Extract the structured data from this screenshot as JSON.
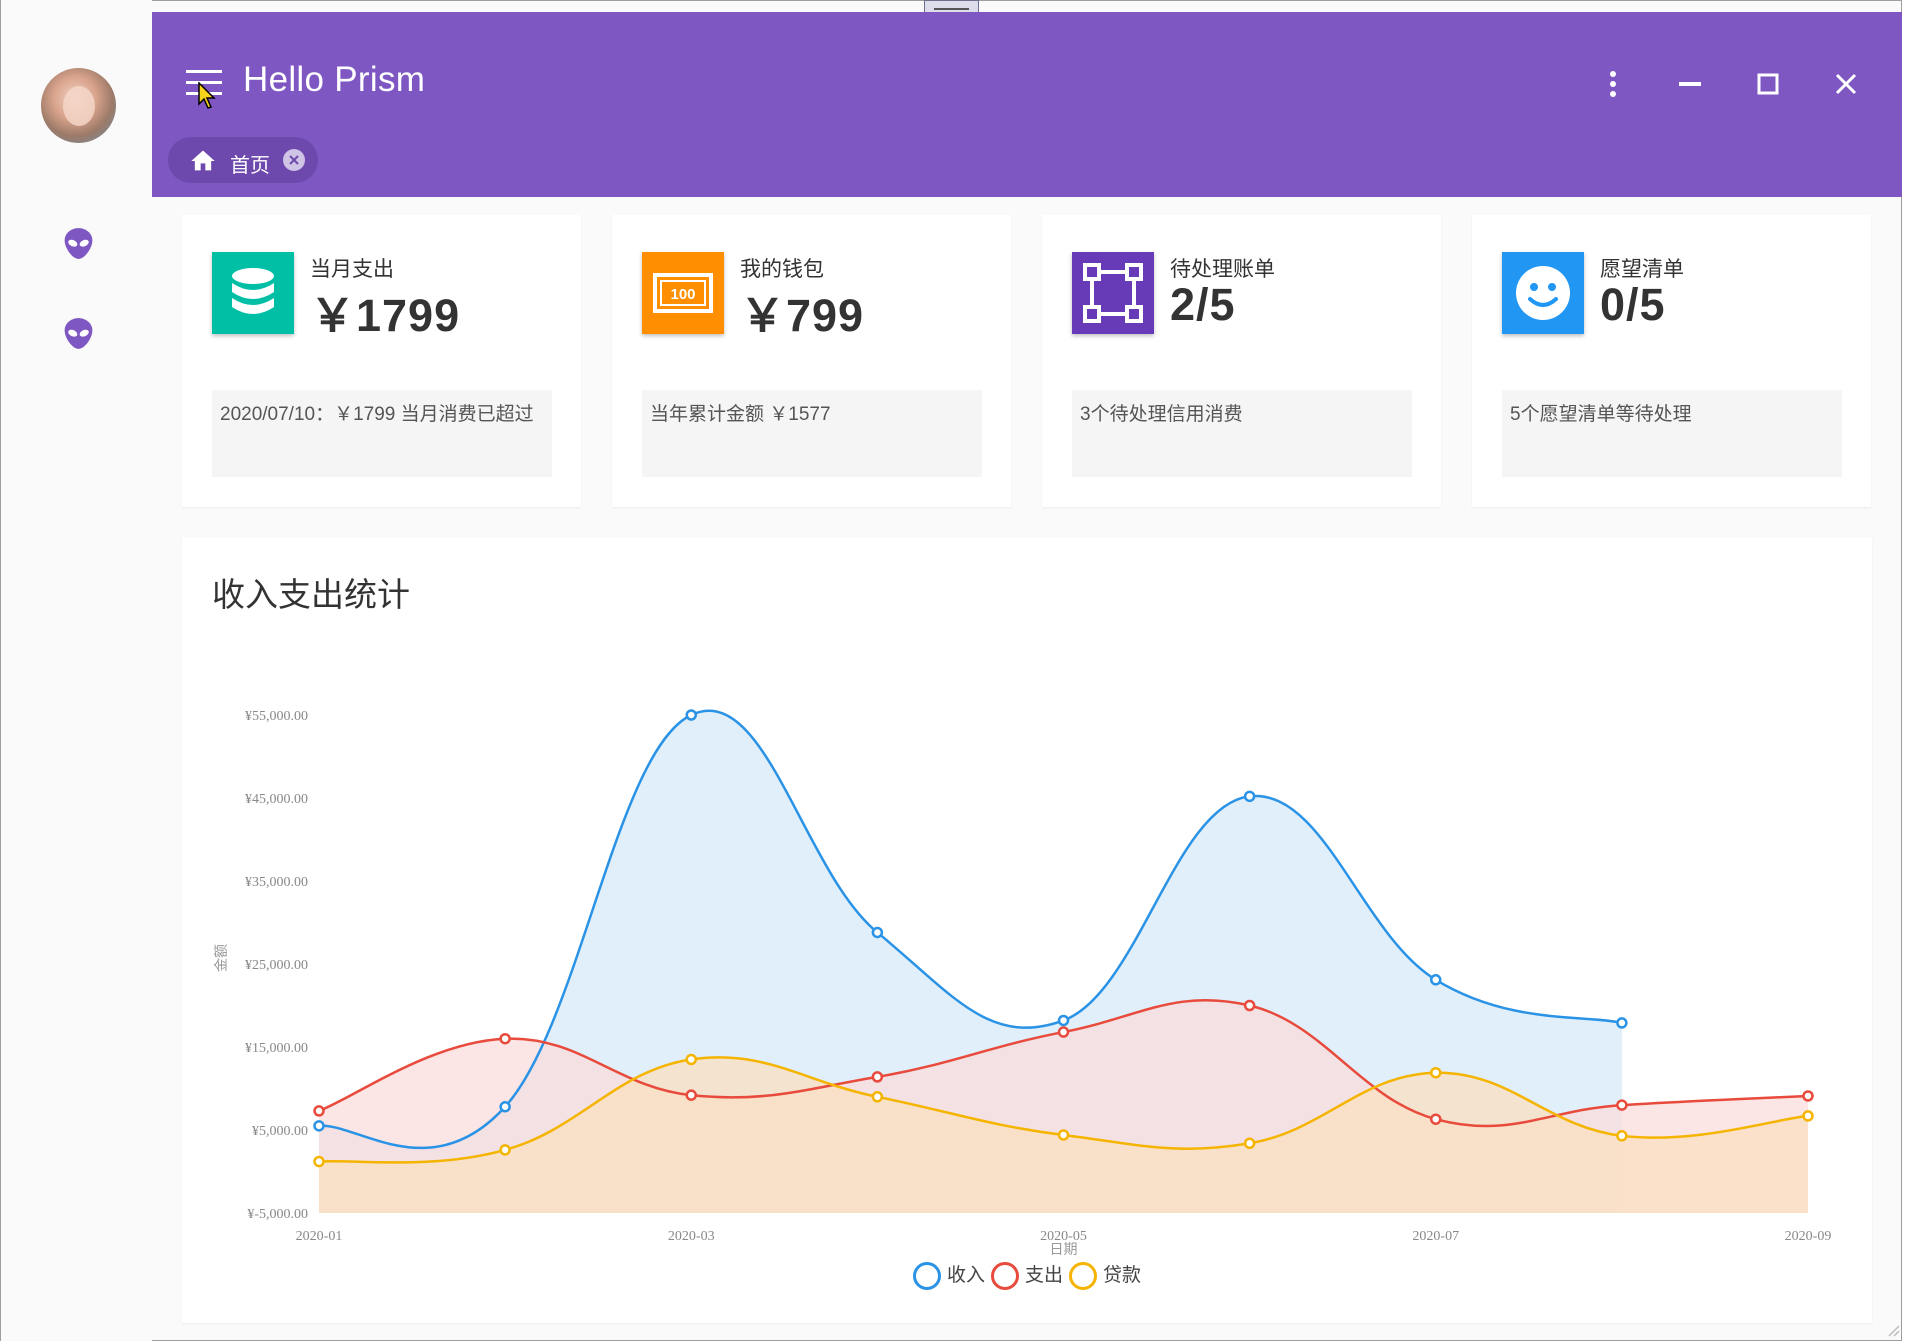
{
  "window": {
    "title": "Hello Prism",
    "tab": {
      "label": "首页"
    }
  },
  "colors": {
    "header": "#7e57c2",
    "card_teal": "#00bfa5",
    "card_orange": "#ff8f00",
    "card_purple": "#673ab7",
    "card_blue": "#2196f3"
  },
  "sidebar": {
    "items": [
      {
        "icon": "alien-icon"
      },
      {
        "icon": "alien-icon"
      }
    ]
  },
  "cards": [
    {
      "title": "当月支出",
      "value": "￥1799",
      "desc": "2020/07/10：￥1799  当月消费已超过",
      "icon": "database-icon",
      "color": "#00bfa5"
    },
    {
      "title": "我的钱包",
      "value": "￥799",
      "desc": "当年累计金额  ￥1577",
      "icon": "banknote-icon",
      "color": "#ff8f00"
    },
    {
      "title": "待处理账单",
      "value": "2/5",
      "desc": "3个待处理信用消费",
      "icon": "vector-square-icon",
      "color": "#673ab7"
    },
    {
      "title": "愿望清单",
      "value": "0/5",
      "desc": "5个愿望清单等待处理",
      "icon": "smiley-icon",
      "color": "#2196f3"
    }
  ],
  "chart_title": "收入支出统计",
  "chart_data": {
    "type": "area",
    "x": [
      "2020-01",
      "2020-02",
      "2020-03",
      "2020-04",
      "2020-05",
      "2020-06",
      "2020-07",
      "2020-08",
      "2020-09"
    ],
    "xtick_labels": [
      "2020-01",
      "2020-03",
      "2020-05",
      "2020-07",
      "2020-09"
    ],
    "ytick_labels": [
      "¥-5,000.00",
      "¥5,000.00",
      "¥15,000.00",
      "¥25,000.00",
      "¥35,000.00",
      "¥45,000.00",
      "¥55,000.00"
    ],
    "ylim": [
      -5000,
      55000
    ],
    "xlabel": "日期",
    "ylabel": "金额",
    "series": [
      {
        "name": "收入",
        "color": "#2b93e6",
        "fill": "#d6e9f8",
        "values": [
          5500,
          7800,
          55000,
          28800,
          18200,
          45200,
          23100,
          17900,
          null
        ]
      },
      {
        "name": "支出",
        "color": "#e84a3c",
        "fill": "#f9dcdc",
        "values": [
          7300,
          16000,
          9200,
          11400,
          16800,
          20000,
          6300,
          8000,
          9100
        ]
      },
      {
        "name": "贷款",
        "color": "#f4b400",
        "fill": "#fbdfc0",
        "values": [
          1200,
          2600,
          13500,
          9000,
          4400,
          3400,
          11900,
          4300,
          6700
        ]
      }
    ],
    "grid": false,
    "legend": "bottom-center"
  }
}
